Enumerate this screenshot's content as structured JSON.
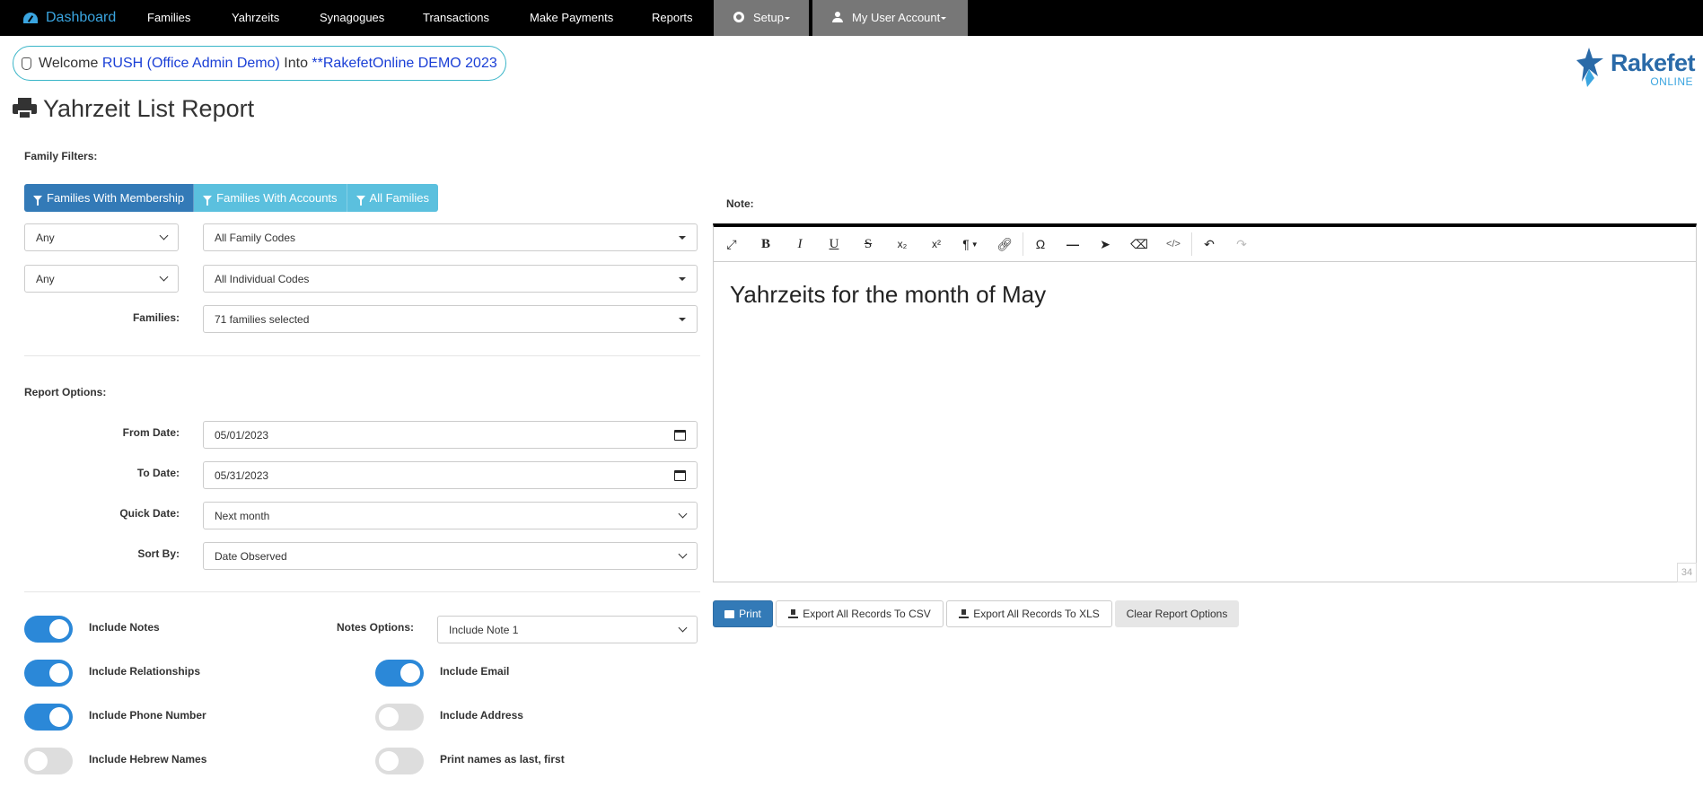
{
  "nav": {
    "brand": "Dashboard",
    "items": [
      "Families",
      "Yahrzeits",
      "Synagogues",
      "Transactions",
      "Make Payments",
      "Reports"
    ],
    "setup": "Setup",
    "account": "My User Account"
  },
  "welcome": {
    "prefix": "Welcome",
    "user": "RUSH (Office Admin Demo)",
    "middle": "Into",
    "org": "**RakefetOnline DEMO 2023"
  },
  "logo": {
    "word": "Rakefet",
    "sub": "ONLINE"
  },
  "page_title": "Yahrzeit List Report",
  "family_filters": {
    "label": "Family Filters:",
    "buttons": [
      "Families With Membership",
      "Families With Accounts",
      "All Families"
    ],
    "row1": {
      "any": "Any",
      "codes": "All Family Codes"
    },
    "row2": {
      "any": "Any",
      "codes": "All Individual Codes"
    },
    "families_label": "Families:",
    "families_value": "71 families selected"
  },
  "report_options": {
    "label": "Report Options:",
    "from_label": "From Date:",
    "from_value": "05/01/2023",
    "to_label": "To Date:",
    "to_value": "05/31/2023",
    "quick_label": "Quick Date:",
    "quick_value": "Next month",
    "sort_label": "Sort By:",
    "sort_value": "Date Observed"
  },
  "toggles": {
    "include_notes": {
      "label": "Include Notes",
      "on": true
    },
    "notes_options_label": "Notes Options:",
    "notes_options_value": "Include Note 1",
    "include_relationships": {
      "label": "Include Relationships",
      "on": true
    },
    "include_email": {
      "label": "Include Email",
      "on": true
    },
    "include_phone": {
      "label": "Include Phone Number",
      "on": true
    },
    "include_address": {
      "label": "Include Address",
      "on": false
    },
    "include_hebrew": {
      "label": "Include Hebrew Names",
      "on": false
    },
    "print_last_first": {
      "label": "Print names as last, first",
      "on": false
    }
  },
  "note": {
    "label": "Note:",
    "content": "Yahrzeits for the month of May",
    "counter": "34"
  },
  "actions": {
    "print": "Print",
    "export_csv": "Export All Records To CSV",
    "export_xls": "Export All Records To XLS",
    "clear": "Clear Report Options"
  },
  "colors": {
    "brand": "#3aa5e0",
    "primary": "#337ab7",
    "info": "#5bc0de",
    "toggle_on": "#2b88d8"
  }
}
